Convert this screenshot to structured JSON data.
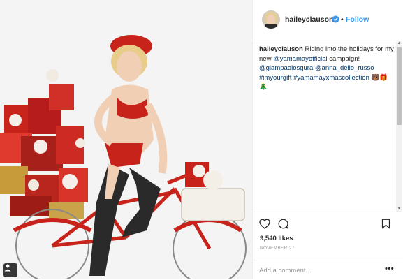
{
  "post": {
    "image_alt": "Woman in red lingerie riding a red bicycle loaded with wrapped presents",
    "tag_icon": "person-tag-icon"
  },
  "header": {
    "username": "haileyclauson",
    "verified_icon": "verified-badge-icon",
    "separator": "•",
    "follow_label": "Follow"
  },
  "caption": {
    "username": "haileyclauson",
    "text_1": "Riding into the holidays for my new",
    "mention_1": "@yamamayofficial",
    "text_2": "campaign!",
    "mention_2": "@giampaolosgura",
    "mention_3": "@anna_dello_russo",
    "hashtag_1": "#imyourgift",
    "hashtag_2": "#yamamayxmascollection",
    "emoji_1": "🐻🎁",
    "emoji_2": "🎄"
  },
  "actions": {
    "like_icon": "heart-icon",
    "comment_icon": "comment-icon",
    "save_icon": "bookmark-icon",
    "likes": "9,540 likes",
    "date": "NOVEMBER 27"
  },
  "comment_box": {
    "placeholder": "Add a comment...",
    "more_label": "•••"
  },
  "colors": {
    "accent": "#3897f0",
    "link": "#003569",
    "text": "#262626",
    "muted": "#999999"
  }
}
